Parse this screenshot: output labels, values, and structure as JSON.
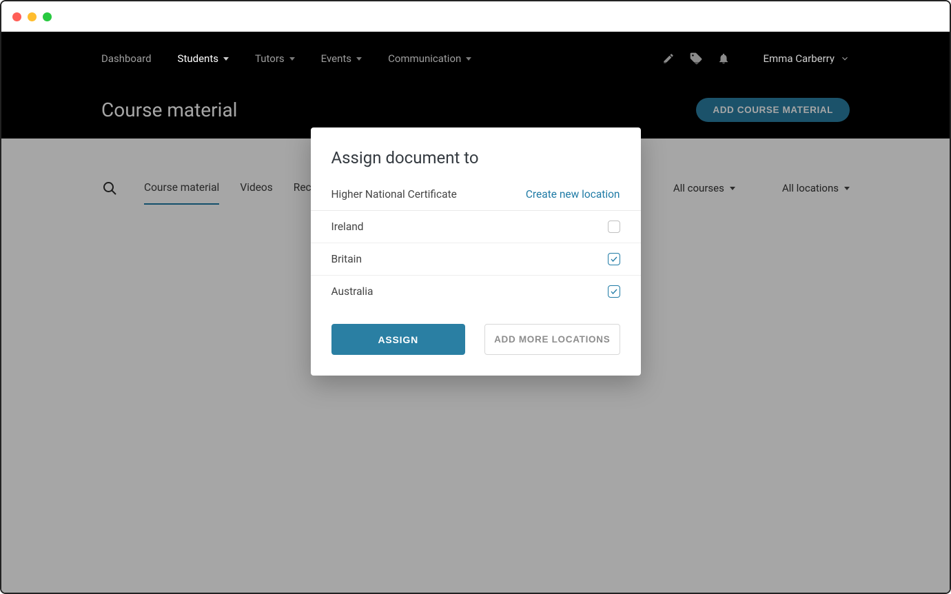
{
  "nav": {
    "items": [
      {
        "label": "Dashboard",
        "has_dropdown": false
      },
      {
        "label": "Students",
        "has_dropdown": true,
        "active": true
      },
      {
        "label": "Tutors",
        "has_dropdown": true
      },
      {
        "label": "Events",
        "has_dropdown": true
      },
      {
        "label": "Communication",
        "has_dropdown": true
      }
    ],
    "user_name": "Emma Carberry"
  },
  "page": {
    "title": "Course material",
    "add_button": "ADD COURSE MATERIAL"
  },
  "tabs": [
    {
      "label": "Course material",
      "active": true
    },
    {
      "label": "Videos"
    },
    {
      "label": "Recommended Reading"
    }
  ],
  "filters": {
    "courses": "All courses",
    "locations": "All locations"
  },
  "modal": {
    "title": "Assign document to",
    "subtitle": "Higher National Certificate",
    "create_link": "Create new location",
    "locations": [
      {
        "name": "Ireland",
        "checked": false
      },
      {
        "name": "Britain",
        "checked": true
      },
      {
        "name": "Australia",
        "checked": true
      }
    ],
    "assign_label": "ASSIGN",
    "add_more_label": "ADD MORE LOCATIONS"
  }
}
